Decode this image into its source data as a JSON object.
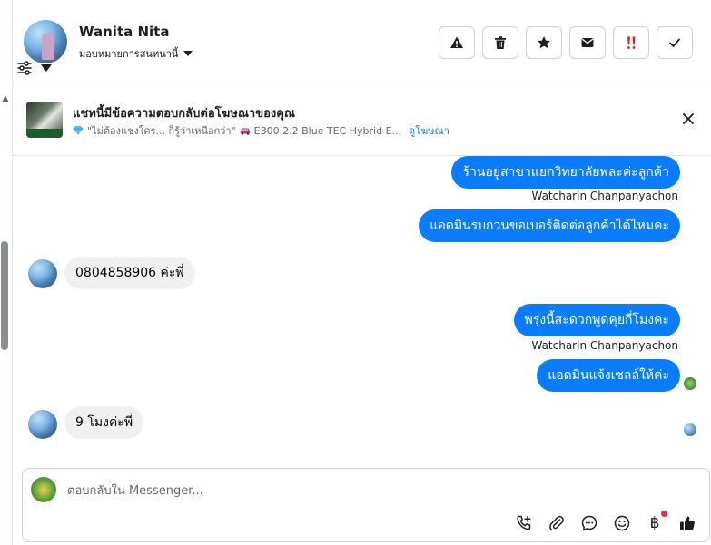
{
  "header": {
    "contact_name": "Wanita Nita",
    "assign_label": "มอบหมายการสนทนานี้",
    "actions": [
      {
        "icon": "warning-icon"
      },
      {
        "icon": "trash-icon"
      },
      {
        "icon": "star-icon"
      },
      {
        "icon": "envelope-icon"
      },
      {
        "icon": "double-exclamation-icon",
        "color": "#e02020"
      },
      {
        "icon": "checkmark-icon"
      }
    ]
  },
  "ad": {
    "title": "แชทนี้มีข้อความตอบกลับต่อโฆษณาของคุณ",
    "subtitle_1": "\"ไม่ต้องแชงใคร... ก็รู้ว่าเหนือกว่า\"",
    "subtitle_2": "E300 2.2 Blue TEC Hybrid E...",
    "link": "ดูโฆษณา"
  },
  "messages": [
    {
      "text": "ร้านอยู่สาขาแยกวิทยาลัยพละค่ะลูกค้า"
    },
    {
      "sender": "Watcharin Chanpanyachon"
    },
    {
      "text": "แอดมินรบกวนขอเบอร์ติดต่อลูกค้าได้ไหมคะ"
    },
    {
      "text": "0804858906 ค่ะพี่"
    },
    {
      "text": "พรุ่งนี้สะดวกพูดคุยกี่โมงคะ"
    },
    {
      "sender": "Watcharin Chanpanyachon"
    },
    {
      "text": "แอดมินแจ้งเซลล์ให้ค่ะ"
    },
    {
      "text": "9 โมงค่ะพี่"
    }
  ],
  "composer": {
    "placeholder": "ตอบกลับใน Messenger...",
    "baht_symbol": "฿"
  },
  "colors": {
    "accent": "#0a7cff",
    "incoming_bubble": "#f0f0f0"
  }
}
